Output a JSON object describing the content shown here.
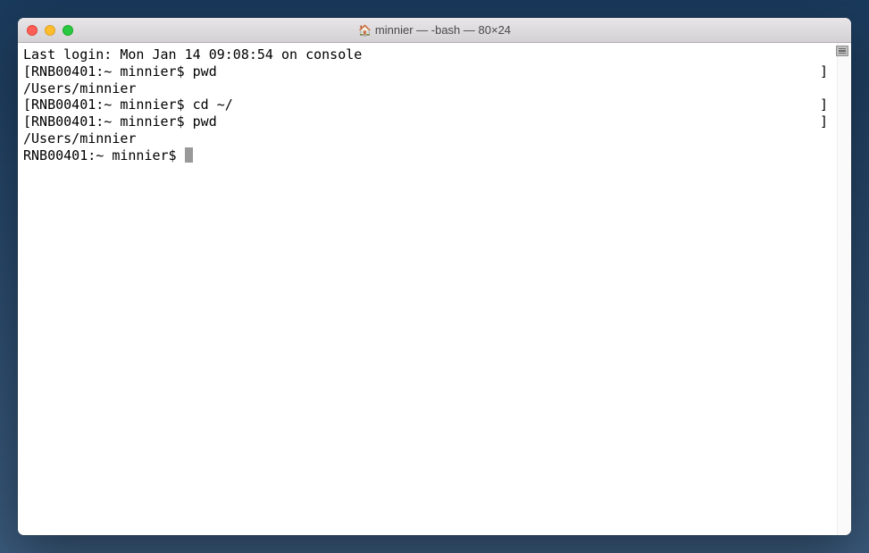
{
  "window": {
    "title": "minnier — -bash — 80×24"
  },
  "terminal": {
    "lastLogin": "Last login: Mon Jan 14 09:08:54 on console",
    "lines": [
      {
        "prompt": "RNB00401:~ minnier$ ",
        "command": "pwd",
        "hasBrackets": true
      },
      {
        "output": "/Users/minnier"
      },
      {
        "prompt": "RNB00401:~ minnier$ ",
        "command": "cd ~/",
        "hasBrackets": true
      },
      {
        "prompt": "RNB00401:~ minnier$ ",
        "command": "pwd",
        "hasBrackets": true
      },
      {
        "output": "/Users/minnier"
      },
      {
        "prompt": "RNB00401:~ minnier$ ",
        "command": "",
        "hasBrackets": false,
        "cursor": true
      }
    ],
    "brackets": {
      "left": "[",
      "right": "]"
    }
  }
}
